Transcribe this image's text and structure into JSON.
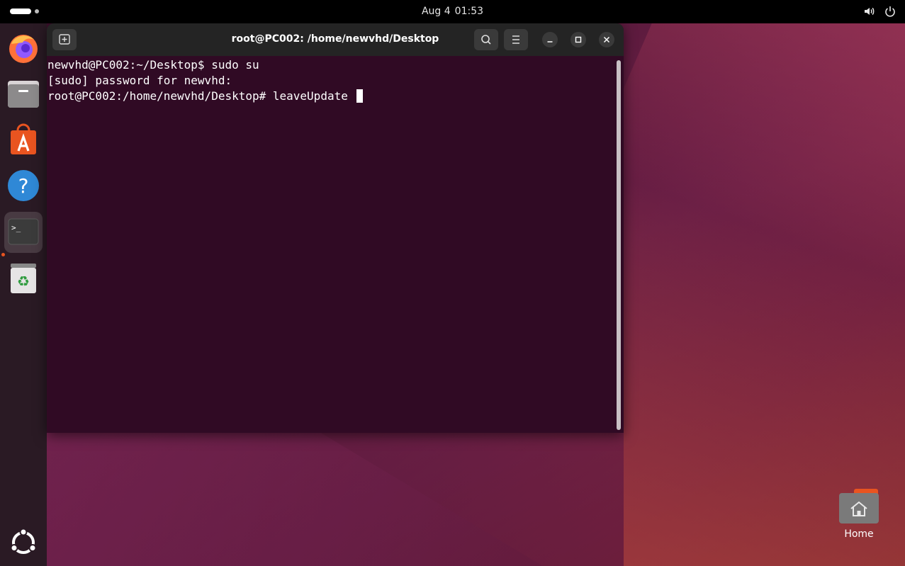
{
  "topbar": {
    "date": "Aug 4",
    "time": "01:53"
  },
  "dock": {
    "items": [
      {
        "name": "Firefox"
      },
      {
        "name": "Files"
      },
      {
        "name": "App Center"
      },
      {
        "name": "Help"
      },
      {
        "name": "Terminal",
        "active": true
      },
      {
        "name": "Trash"
      }
    ]
  },
  "terminal": {
    "title": "root@PC002: /home/newvhd/Desktop",
    "lines": [
      "newvhd@PC002:~/Desktop$ sudo su",
      "[sudo] password for newvhd:",
      "root@PC002:/home/newvhd/Desktop# leaveUpdate "
    ]
  },
  "desktop": {
    "home_label": "Home"
  },
  "colors": {
    "terminal_bg": "#300a24",
    "titlebar_bg": "#242424",
    "accent": "#e95420"
  }
}
